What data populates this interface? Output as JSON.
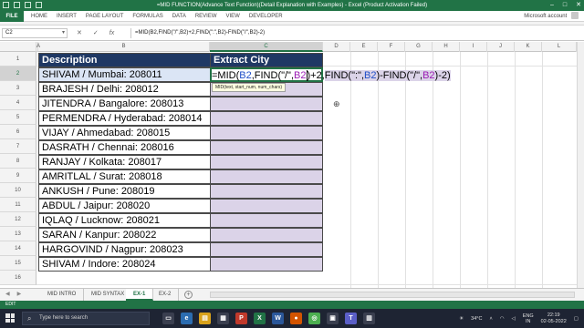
{
  "window": {
    "title": "=MID FUNCTION(Advance Text Function)(Detail Explanation with Examples) - Excel (Product Activation Failed)",
    "minimize": "–",
    "restore": "□",
    "close": "✕"
  },
  "ribbon": {
    "file_tab": "FILE",
    "tabs": [
      "HOME",
      "INSERT",
      "PAGE LAYOUT",
      "FORMULAS",
      "DATA",
      "REVIEW",
      "VIEW",
      "DEVELOPER"
    ],
    "account": "Microsoft account"
  },
  "formula_bar": {
    "name_box": "C2",
    "cancel": "✕",
    "enter": "✓",
    "fx": "fx",
    "formula": "=MID(B2,FIND(\"/\",B2)+2,FIND(\":\",B2)-FIND(\"/\",B2)-2)"
  },
  "columns": [
    "A",
    "B",
    "C",
    "D",
    "E",
    "F",
    "G",
    "H",
    "I",
    "J",
    "K",
    "L"
  ],
  "rows": [
    "1",
    "2",
    "3",
    "4",
    "5",
    "6",
    "7",
    "8",
    "9",
    "10",
    "11",
    "12",
    "13",
    "14",
    "15",
    "16"
  ],
  "table": {
    "header_description": "Description",
    "header_extract": "Extract City",
    "descriptions": [
      "SHIVAM / Mumbai: 208011",
      "BRAJESH / Delhi: 208012",
      "JITENDRA / Bangalore: 208013",
      "PERMENDRA / Hyderabad: 208014",
      "VIJAY / Ahmedabad: 208015",
      "DASRATH / Chennai: 208016",
      "RANJAY / Kolkata: 208017",
      "AMRITLAL / Surat: 208018",
      "ANKUSH / Pune: 208019",
      "ABDUL / Jaipur: 208020",
      "IQLAQ / Lucknow: 208021",
      "SARAN / Kanpur: 208022",
      "HARGOVIND / Nagpur: 208023",
      "SHIVAM / Indore: 208024"
    ]
  },
  "editing": {
    "p1": "=MID(",
    "p2": "B2",
    "p3": ",FIND(\"/\",",
    "p4": "B2",
    "p5": ")+2,",
    "p6": "FIND(\":\",",
    "p7": "B2",
    "p8": ")-FIND(\"/\",",
    "p9": "B2",
    "p10": ")-2)",
    "tooltip": "MID(text, start_num, num_chars)"
  },
  "sheets": {
    "tabs": [
      "MID INTRO",
      "MID SYNTAX",
      "EX-1",
      "EX-2"
    ],
    "active": "EX-1",
    "add": "+"
  },
  "status": {
    "mode": "EDIT"
  },
  "taskbar": {
    "search_placeholder": "Type here to search",
    "weather": "34°C",
    "lang1": "ENG",
    "lang2": "IN",
    "time": "22:19",
    "date": "02-05-2022"
  },
  "colors": {
    "excel_green": "#217346",
    "header_fill": "#1f3864",
    "extract_fill": "#dbd3e8",
    "ref_blue": "#1f4ec8",
    "ref_purple": "#9b1bb4"
  }
}
